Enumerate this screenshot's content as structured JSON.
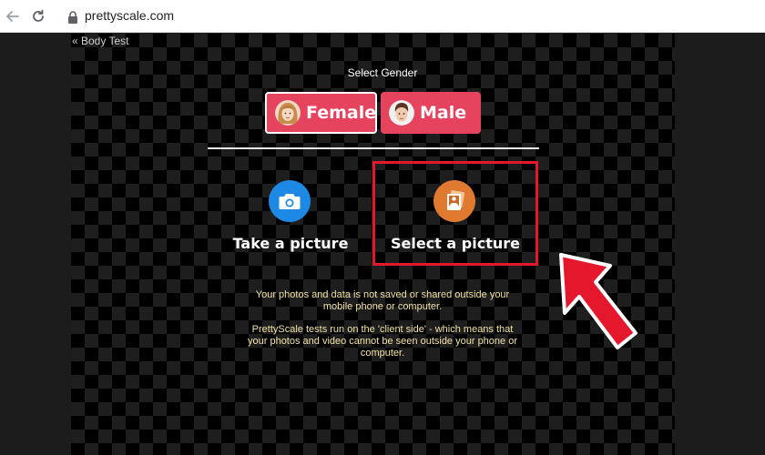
{
  "browser": {
    "url": "prettyscale.com"
  },
  "page": {
    "back_link": "« Body Test",
    "gender_label": "Select Gender",
    "gender_options": [
      {
        "label": "Female",
        "selected": true
      },
      {
        "label": "Male",
        "selected": false
      }
    ],
    "options": {
      "take": "Take a picture",
      "select": "Select a picture"
    },
    "notices": [
      "Your photos and data is not saved or shared outside your mobile phone or computer.",
      "PrettyScale tests run on the 'client side' - which means that your photos and video cannot be seen outside your phone or computer."
    ]
  },
  "colors": {
    "gender_button": "#e6435f",
    "camera_icon_bg": "#1e88e5",
    "gallery_icon_bg": "#e07a30",
    "highlight": "#e5172c",
    "notice_text": "#f2e2a4"
  }
}
